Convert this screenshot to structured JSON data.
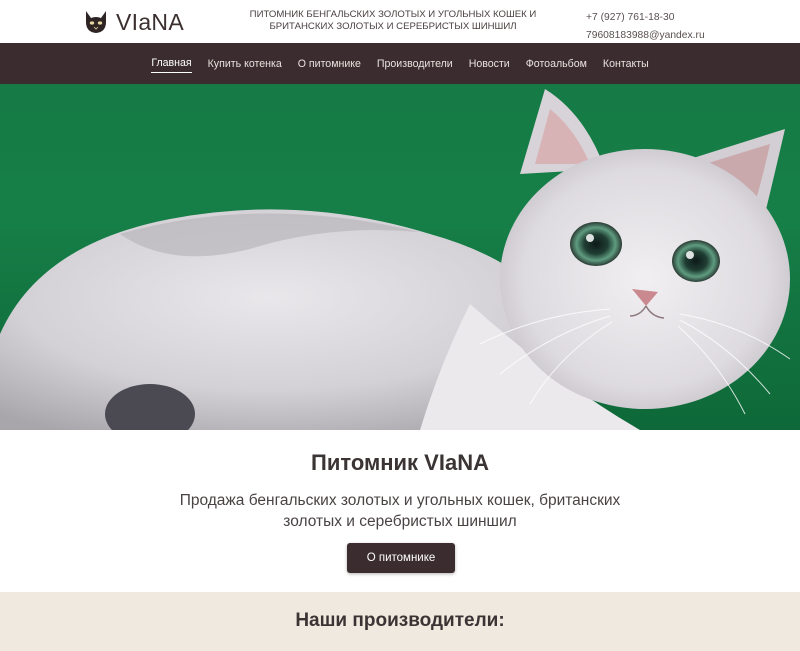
{
  "header": {
    "logo_text": "VIaNA",
    "tagline": "ПИТОМНИК БЕНГАЛЬСКИХ ЗОЛОТЫХ И УГОЛЬНЫХ КОШЕК И БРИТАНСКИХ ЗОЛОТЫХ И СЕРЕБРИСТЫХ ШИНШИЛ",
    "phone": "+7 (927) 761-18-30",
    "email": "79608183988@yandex.ru"
  },
  "nav": {
    "items": [
      {
        "label": "Главная",
        "active": true
      },
      {
        "label": "Купить котенка"
      },
      {
        "label": "О питомнике"
      },
      {
        "label": "Производители"
      },
      {
        "label": "Новости"
      },
      {
        "label": "Фотоальбом"
      },
      {
        "label": "Контакты"
      }
    ]
  },
  "intro": {
    "title": "Питомник VIaNA",
    "subtitle": "Продажа бенгальских золотых и угольных кошек, британских золотых и серебристых шиншил",
    "button_label": "О питомнике"
  },
  "producers": {
    "title": "Наши производители:"
  },
  "colors": {
    "nav_bg": "#3b2d2f",
    "hero_bg": "#157a45",
    "producers_bg": "#efe9df"
  }
}
